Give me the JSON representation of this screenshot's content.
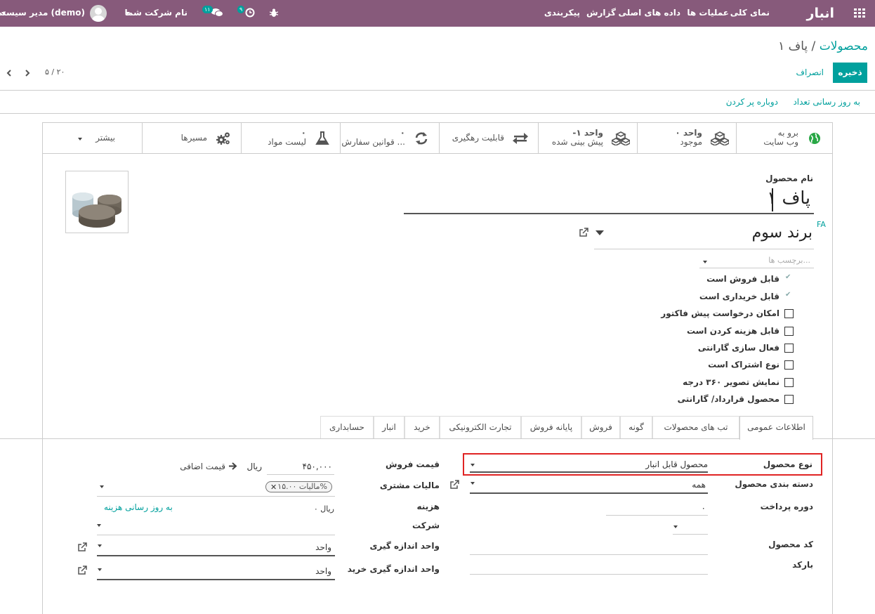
{
  "navbar": {
    "app_title": "انبار",
    "menu": [
      "نمای کلی",
      "عملیات ها",
      "داده های اصلی",
      "گزارش",
      "پیکربندی"
    ],
    "company": "نام شرکت شما",
    "user": "مدیر سیستم (demo)",
    "messages_badge": "۱۱",
    "activities_badge": "۹",
    "bg_color": "#875a7b"
  },
  "breadcrumb": {
    "parent": "محصولات",
    "separator": "/",
    "current": "پاف ۱"
  },
  "actions": {
    "save": "ذخیره",
    "discard": "انصراف"
  },
  "pager": {
    "value": "۵ / ۲۰"
  },
  "header_buttons": {
    "update_qty": "به روز رسانی تعداد",
    "replenish": "دوباره پر کردن"
  },
  "smart_buttons": [
    {
      "name": "website",
      "line1": "برو به",
      "line2": "وب سایت",
      "icon": "globe-icon"
    },
    {
      "name": "on-hand",
      "line1": "۰ واحد",
      "line2": "موجود",
      "icon": "cubes-icon"
    },
    {
      "name": "forecasted",
      "line1": "-۱ واحد",
      "line2": "پیش بینی شده",
      "icon": "cubes-icon"
    },
    {
      "name": "traceability",
      "line1": "قابلیت رهگیری",
      "line2": "",
      "icon": "exchange-icon"
    },
    {
      "name": "reorder-rules",
      "line1": "۰",
      "line2": "قوانین سفارش ...",
      "icon": "refresh-icon"
    },
    {
      "name": "bom",
      "line1": "۰",
      "line2": "لیست مواد",
      "icon": "flask-icon"
    },
    {
      "name": "routes",
      "line1": "مسیرها",
      "line2": "",
      "icon": "gears-icon"
    },
    {
      "name": "more",
      "line1": "بیشتر",
      "line2": "",
      "icon": "caret-down-icon"
    }
  ],
  "product": {
    "name_label": "نام محصول",
    "name": "پاف ۱",
    "lang_tag": "FA",
    "brand": "برند سوم",
    "tags_placeholder": "برچسب ها..."
  },
  "options": [
    {
      "label": "قابل فروش است",
      "checked": true
    },
    {
      "label": "قابل خریداری است",
      "checked": true
    },
    {
      "label": "امکان درخواست پیش فاکتور",
      "checked": false
    },
    {
      "label": "قابل هزینه کردن است",
      "checked": false
    },
    {
      "label": "فعال سازی گارانتی",
      "checked": false
    },
    {
      "label": "نوع اشتراک است",
      "checked": false
    },
    {
      "label": "نمایش تصویر ۳۶۰ درجه",
      "checked": false
    },
    {
      "label": "محصول قرارداد/ گارانتی",
      "checked": false
    }
  ],
  "tabs": [
    "اطلاعات عمومی",
    "تب های محصولات",
    "گونه",
    "فروش",
    "پایانه فروش",
    "تجارت الکترونیکی",
    "خرید",
    "انبار",
    "حسابداری"
  ],
  "fields_right": {
    "product_type_label": "نوع محصول",
    "product_type_value": "محصول قابل انبار",
    "category_label": "دسته بندی محصول",
    "category_value": "همه",
    "payment_period_label": "دوره پرداخت",
    "payment_period_value": "۰",
    "internal_ref_label": "کد محصول",
    "barcode_label": "بارکد"
  },
  "fields_left": {
    "sales_price_label": "قیمت فروش",
    "sales_price_value": "۴۵۰,۰۰۰",
    "currency": "ریال",
    "extra_price": "قیمت اضافی",
    "customer_tax_label": "مالیات مشتری",
    "tax_tag": "مالیات ۱۵.۰۰%",
    "cost_label": "هزینه",
    "cost_value": "۰ ریال",
    "update_cost": "به روز رسانی هزینه",
    "company_label": "شرکت",
    "uom_label": "واحد اندازه گیری",
    "uom_value": "واحد",
    "purchase_uom_label": "واحد اندازه گیری خرید",
    "purchase_uom_value": "واحد"
  }
}
